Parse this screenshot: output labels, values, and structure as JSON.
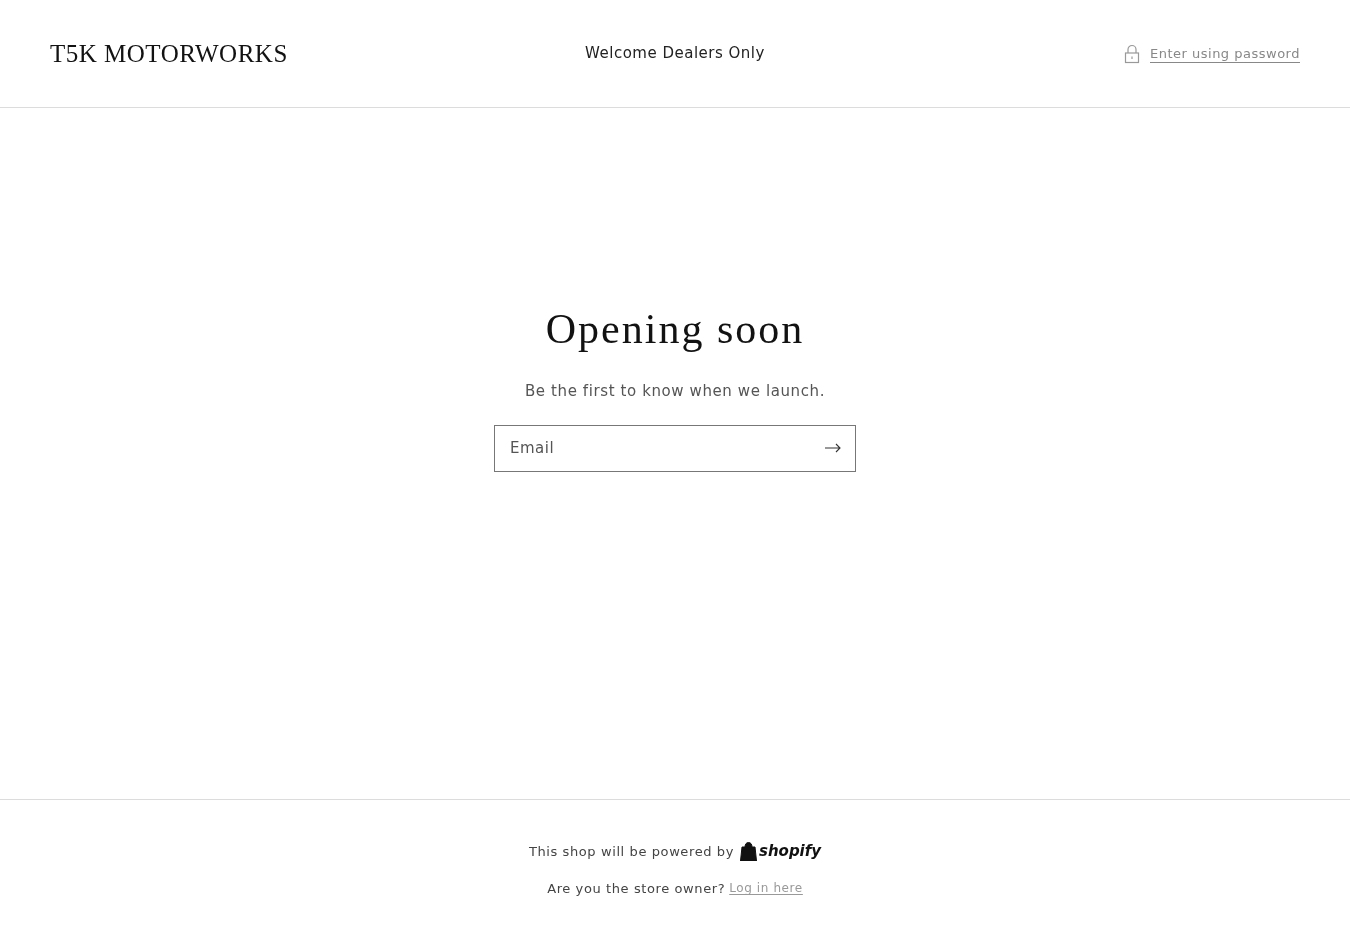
{
  "header": {
    "logo": "T5K MOTORWORKS",
    "announcement": "Welcome Dealers Only",
    "password_link": "Enter using password"
  },
  "main": {
    "heading": "Opening soon",
    "subheading": "Be the first to know when we launch.",
    "email_field": {
      "placeholder": "Email"
    }
  },
  "footer": {
    "powered_by": "This shop will be powered by",
    "shopify_logo": "shopify",
    "owner_question": "Are you the store owner?",
    "login_link": "Log in here"
  }
}
